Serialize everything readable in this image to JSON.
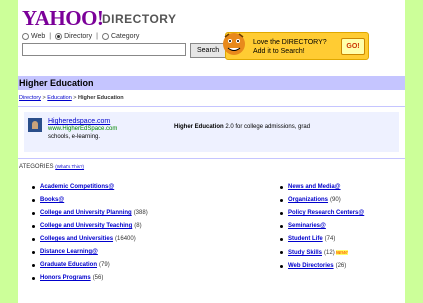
{
  "header": {
    "logo": "YAHOO!",
    "logo_suffix": "DIRECTORY",
    "radios": [
      {
        "label": "Web",
        "checked": false
      },
      {
        "label": "Directory",
        "checked": true
      },
      {
        "label": "Category",
        "checked": false
      }
    ],
    "search_value": "",
    "search_button": "Search",
    "promo_text": "Love the DIRECTORY? Add it to Search!",
    "promo_button": "GO!"
  },
  "section": {
    "title": "Higher Education",
    "breadcrumb": [
      {
        "label": "Directory",
        "link": true
      },
      {
        "label": "Education",
        "link": true
      },
      {
        "label": "Higher Education",
        "link": false
      }
    ],
    "breadcrumb_sep": ">"
  },
  "sponsor": {
    "link": "Higheredspace.com",
    "url": "www.HigherEdSpace.com",
    "desc_left": "schools, e-learning.",
    "desc_bold": "Higher Education",
    "desc_right": " 2.0 for college admissions, grad"
  },
  "categories": {
    "heading": "ATEGORIES",
    "whats_this": "(What's This?)",
    "left": [
      {
        "label": "Academic Competitions@",
        "count": ""
      },
      {
        "label": "Books@",
        "count": ""
      },
      {
        "label": "College and University Planning",
        "count": "(388)"
      },
      {
        "label": "College and University Teaching",
        "count": "(8)"
      },
      {
        "label": "Colleges and Universities",
        "count": "(16400)"
      },
      {
        "label": "Distance Learning@",
        "count": ""
      },
      {
        "label": "Graduate Education",
        "count": "(79)"
      },
      {
        "label": "Honors Programs",
        "count": "(56)"
      }
    ],
    "right": [
      {
        "label": "News and Media@",
        "count": ""
      },
      {
        "label": "Organizations",
        "count": "(90)"
      },
      {
        "label": "Policy Research Centers@",
        "count": ""
      },
      {
        "label": "Seminaries@",
        "count": ""
      },
      {
        "label": "Student Life",
        "count": "(74)"
      },
      {
        "label": "Study Skills",
        "count": "(12)",
        "badge": "NEW!"
      },
      {
        "label": "Web Directories",
        "count": "(26)"
      }
    ]
  },
  "colors": {
    "background": "#ccff99",
    "section_bar": "#c5c5ff",
    "link": "#0000cc",
    "logo": "#7b0099",
    "promo": "#ffcc33"
  }
}
